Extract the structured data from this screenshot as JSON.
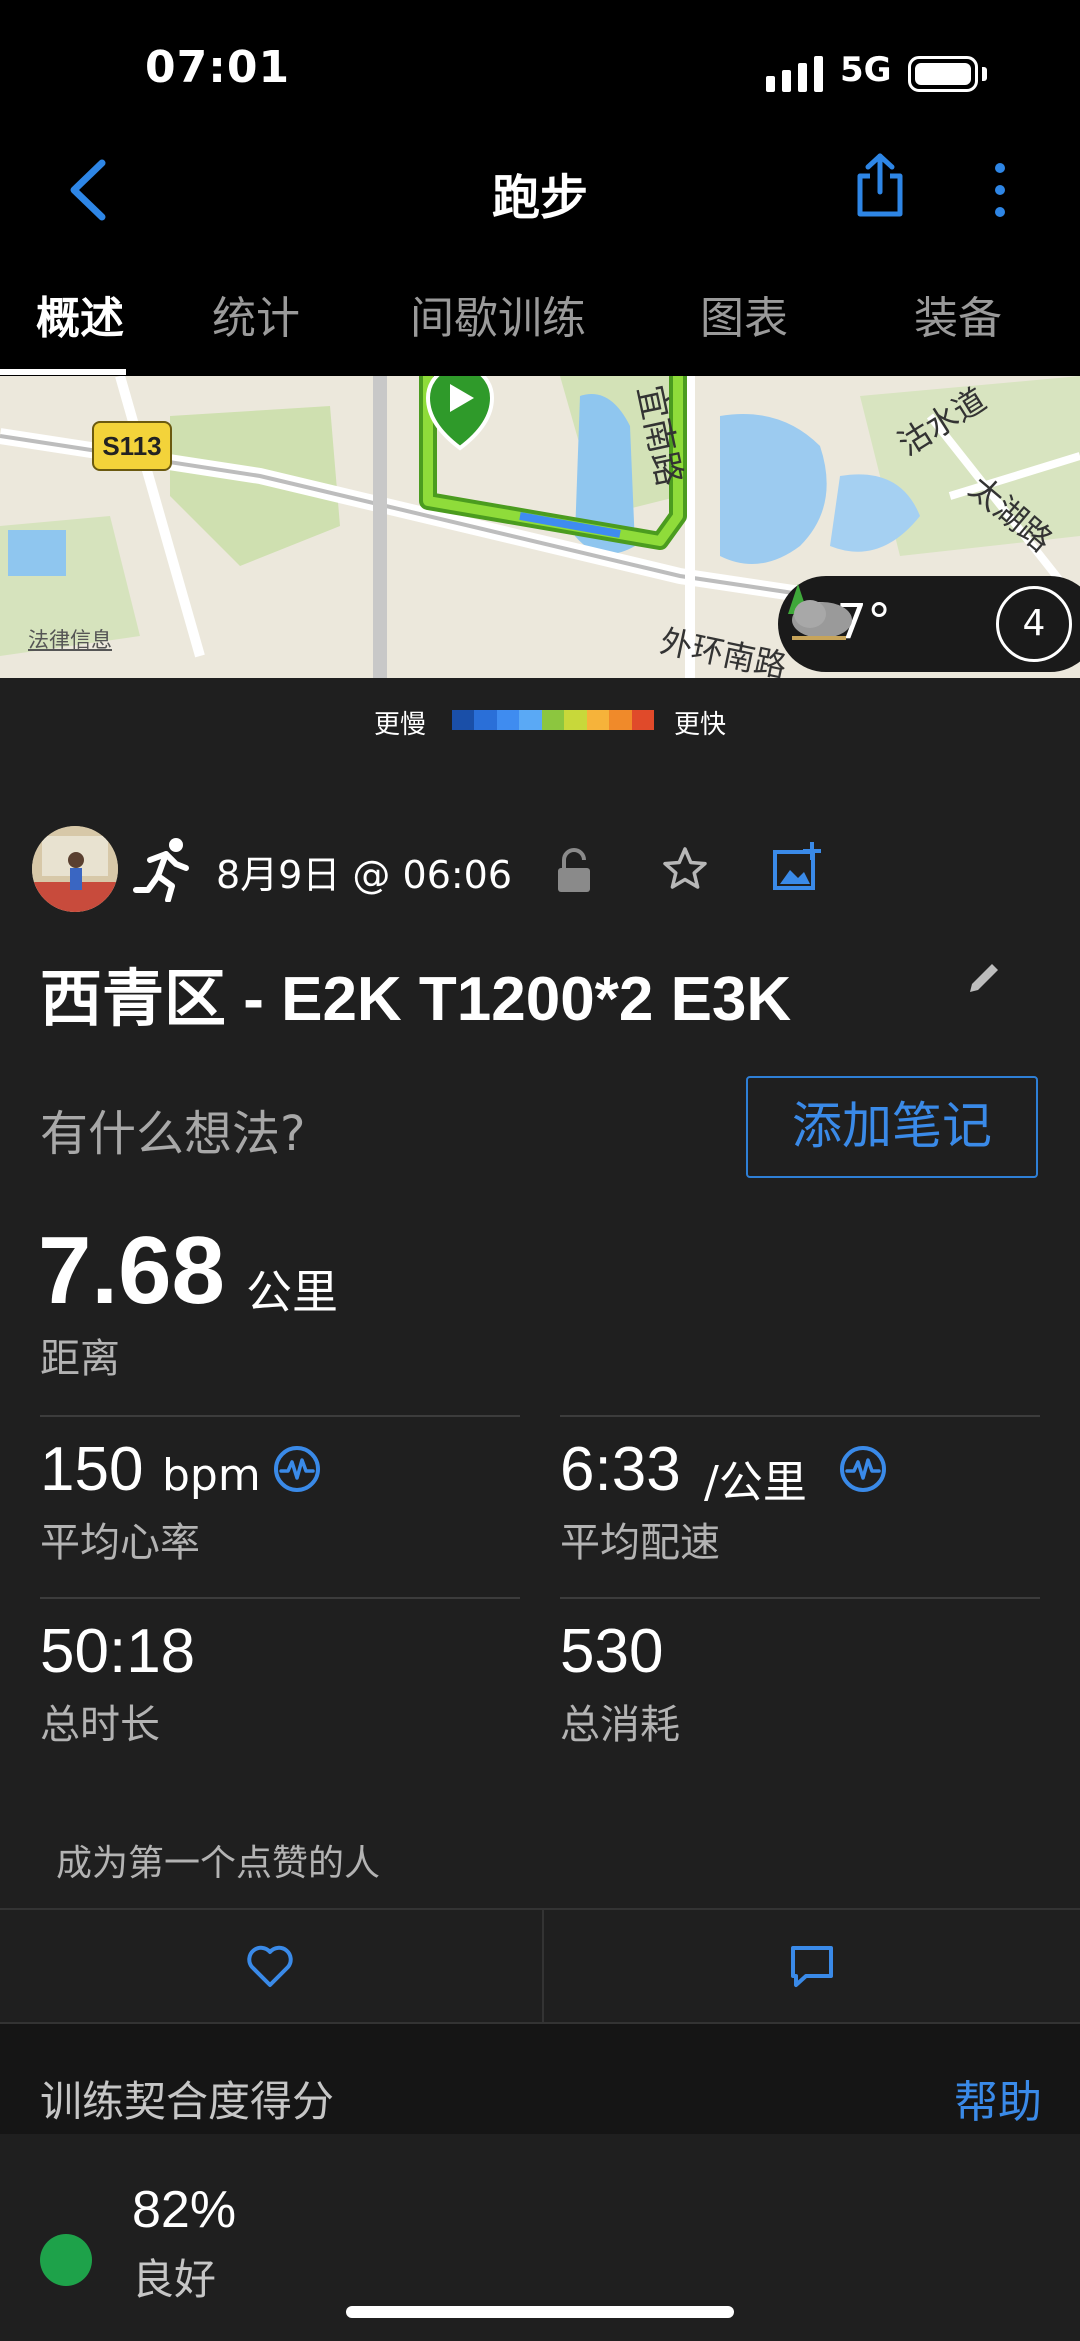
{
  "status_bar": {
    "time": "07:01",
    "network": "5G"
  },
  "nav": {
    "title": "跑步"
  },
  "tabs": [
    {
      "label": "概述",
      "active": true
    },
    {
      "label": "统计"
    },
    {
      "label": "间歇训练"
    },
    {
      "label": "图表"
    },
    {
      "label": "装备"
    }
  ],
  "map": {
    "legal": "法律信息",
    "road_badge": "S113",
    "labels": [
      "宜南路",
      "沽水道",
      "太湖路",
      "外环南路"
    ],
    "weather_temp": "27°",
    "wind": "4"
  },
  "pace_legend": {
    "slow": "更慢",
    "fast": "更快",
    "colors": [
      "#1a4fa8",
      "#2a6fd8",
      "#3f8cf0",
      "#5aa9f5",
      "#8cc63f",
      "#c8d83a",
      "#f6b33a",
      "#f08a2a",
      "#e04a2a"
    ]
  },
  "activity": {
    "date": "8月9日 @ 06:06",
    "title": "西青区 - E2K T1200*2 E3K",
    "thoughts_placeholder": "有什么想法?",
    "add_note": "添加笔记"
  },
  "distance": {
    "value": "7.68",
    "unit": "公里",
    "label": "距离"
  },
  "stats": {
    "avg_hr": {
      "value": "150",
      "unit": "bpm",
      "label": "平均心率"
    },
    "avg_pace": {
      "value": "6:33",
      "unit": "/公里",
      "label": "平均配速"
    },
    "total_time": {
      "value": "50:18",
      "label": "总时长"
    },
    "calories": {
      "value": "530",
      "label": "总消耗"
    }
  },
  "social": {
    "like_prompt": "成为第一个点赞的人"
  },
  "training_fit": {
    "title": "训练契合度得分",
    "help": "帮助",
    "score": "82%",
    "rating": "良好",
    "color": "#1ea24a"
  },
  "colors": {
    "accent": "#3a8ae8",
    "background": "#1f1f1f"
  }
}
